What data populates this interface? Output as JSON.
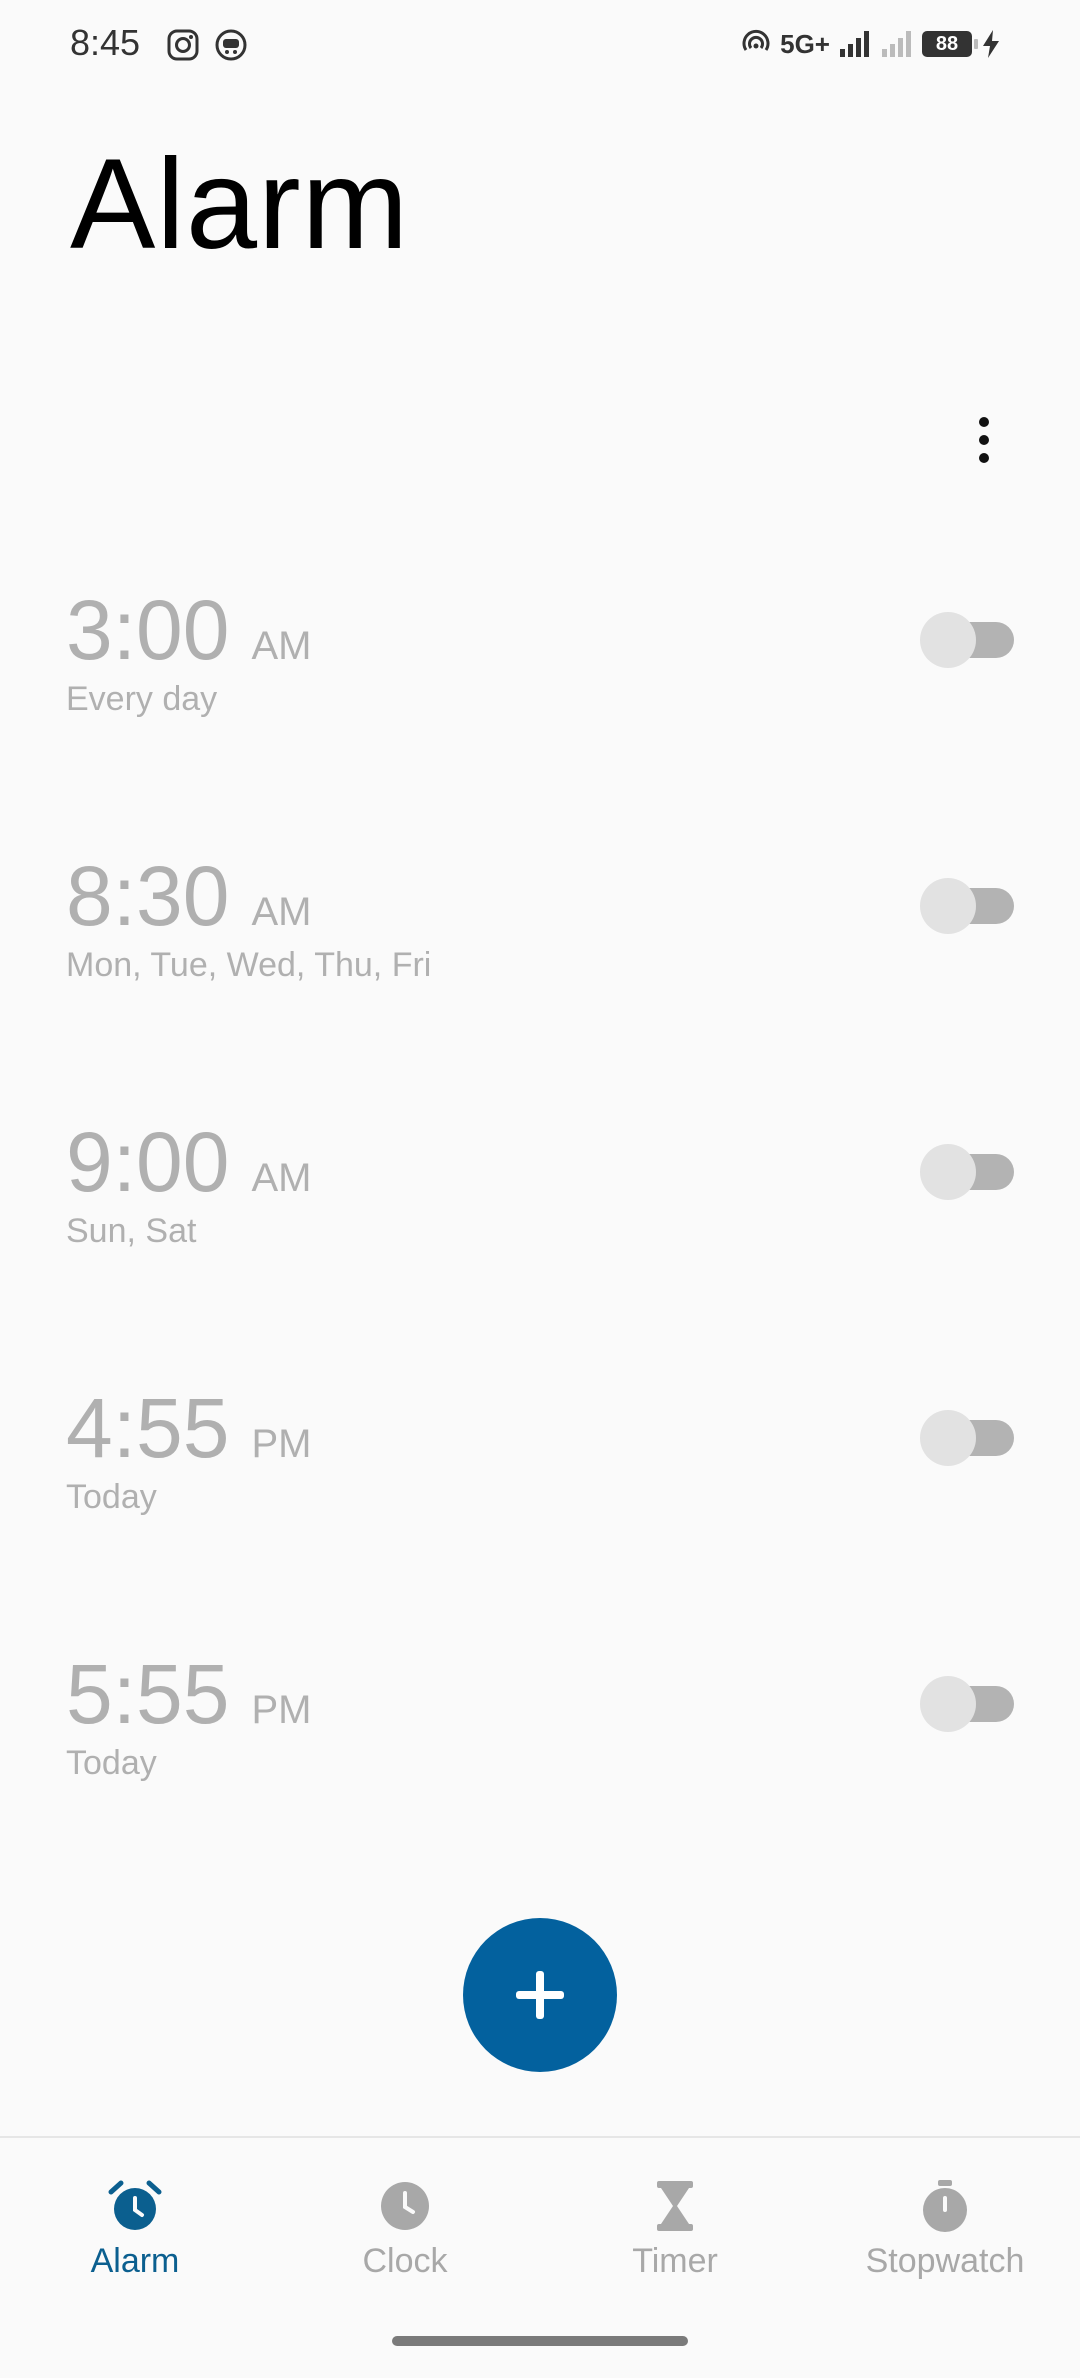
{
  "status_bar": {
    "time": "8:45",
    "network": "5G+",
    "battery": "88"
  },
  "page": {
    "title": "Alarm"
  },
  "alarms": [
    {
      "time": "3:00",
      "ampm": "AM",
      "days": "Every day",
      "enabled": false
    },
    {
      "time": "8:30",
      "ampm": "AM",
      "days": "Mon, Tue, Wed, Thu, Fri",
      "enabled": false
    },
    {
      "time": "9:00",
      "ampm": "AM",
      "days": "Sun, Sat",
      "enabled": false
    },
    {
      "time": "4:55",
      "ampm": "PM",
      "days": "Today",
      "enabled": false
    },
    {
      "time": "5:55",
      "ampm": "PM",
      "days": "Today",
      "enabled": false
    }
  ],
  "nav": {
    "items": [
      {
        "label": "Alarm",
        "icon": "alarm-clock-icon",
        "active": true
      },
      {
        "label": "Clock",
        "icon": "clock-icon",
        "active": false
      },
      {
        "label": "Timer",
        "icon": "hourglass-icon",
        "active": false
      },
      {
        "label": "Stopwatch",
        "icon": "stopwatch-icon",
        "active": false
      }
    ]
  },
  "colors": {
    "accent": "#03619e",
    "nav_active": "#0b5f8f",
    "inactive_text": "#b0b0b0",
    "toggle_track": "#b3b3b3",
    "toggle_thumb": "#e2e2e2"
  }
}
